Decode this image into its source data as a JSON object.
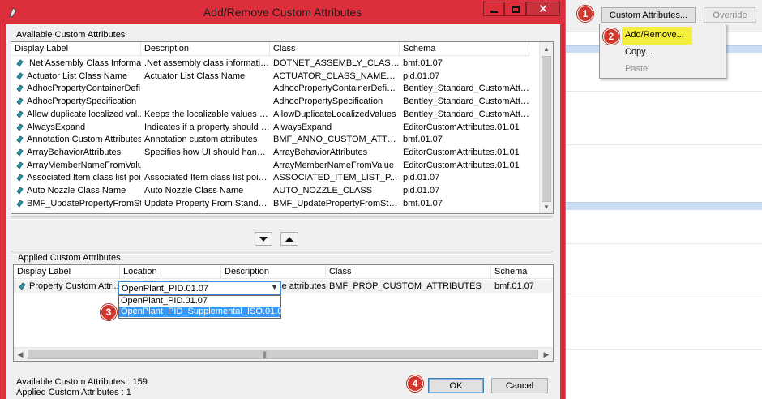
{
  "window": {
    "title": "Add/Remove Custom Attributes",
    "min_icon": "minimize-icon",
    "max_icon": "maximize-icon",
    "close_icon": "close-icon"
  },
  "available": {
    "group_label": "Available Custom Attributes",
    "columns": [
      "Display Label",
      "Description",
      "Class",
      "Schema"
    ],
    "rows": [
      [
        ".Net Assembly Class Informat...",
        ".Net assembly class information",
        "DOTNET_ASSEMBLY_CLASS...",
        "bmf.01.07"
      ],
      [
        "Actuator List Class Name",
        "Actuator List Class Name",
        "ACTUATOR_CLASS_NAME_L...",
        "pid.01.07"
      ],
      [
        "AdhocPropertyContainerDefi...",
        "",
        "AdhocPropertyContainerDefiniti...",
        "Bentley_Standard_CustomAttrib..."
      ],
      [
        "AdhocPropertySpecification",
        "",
        "AdhocPropertySpecification",
        "Bentley_Standard_CustomAttrib..."
      ],
      [
        "Allow duplicate localized val...",
        "Keeps the localizable values fro...",
        "AllowDuplicateLocalizedValues",
        "Bentley_Standard_CustomAttrib..."
      ],
      [
        "AlwaysExpand",
        "Indicates if a property should al...",
        "AlwaysExpand",
        "EditorCustomAttributes.01.01"
      ],
      [
        "Annotation Custom Attributes",
        "Annotation custom attributes",
        "BMF_ANNO_CUSTOM_ATTRI...",
        "bmf.01.07"
      ],
      [
        "ArrayBehaviorAttributes",
        "Specifies how UI should handle...",
        "ArrayBehaviorAttributes",
        "EditorCustomAttributes.01.01"
      ],
      [
        "ArrayMemberNameFromValue",
        "",
        "ArrayMemberNameFromValue",
        "EditorCustomAttributes.01.01"
      ],
      [
        "Associated Item class list poi...",
        "Associated Item class list pointer",
        "ASSOCIATED_ITEM_LIST_P...",
        "pid.01.07"
      ],
      [
        "Auto Nozzle Class Name",
        "Auto Nozzle Class Name",
        "AUTO_NOZZLE_CLASS",
        "pid.01.07"
      ],
      [
        "BMF_UpdatePropertyFromSt...",
        "Update Property From Standard...",
        "BMF_UpdatePropertyFromStan...",
        "bmf.01.07"
      ]
    ],
    "count_text": "Available Custom Attributes : 159"
  },
  "move_down_icon": "arrow-down-icon",
  "move_up_icon": "arrow-up-icon",
  "applied": {
    "group_label": "Applied Custom Attributes",
    "columns": [
      "Display Label",
      "Location",
      "Description",
      "Class",
      "Schema"
    ],
    "row": {
      "label": "Property Custom Attri...",
      "location": "OpenPlant_PID.01.07",
      "description": "e attributes",
      "class": "BMF_PROP_CUSTOM_ATTRIBUTES",
      "schema": "bmf.01.07"
    },
    "location_options": [
      "OpenPlant_PID.01.07",
      "OpenPlant_PID_Supplemental_ISO.01.07"
    ],
    "count_text": "Applied Custom Attributes : 1"
  },
  "buttons": {
    "ok": "OK",
    "cancel": "Cancel"
  },
  "right_pane": {
    "custom_attributes_button": "Custom Attributes...",
    "override_button": "Override",
    "menu": {
      "add_remove": "Add/Remove...",
      "copy": "Copy...",
      "paste": "Paste"
    }
  },
  "step_badges": [
    "1",
    "2",
    "3",
    "4"
  ],
  "colors": {
    "titlebar": "#dd2e3c",
    "highlight": "#f4ef3a",
    "selection": "#3399ff",
    "badge": "#d3362d"
  }
}
